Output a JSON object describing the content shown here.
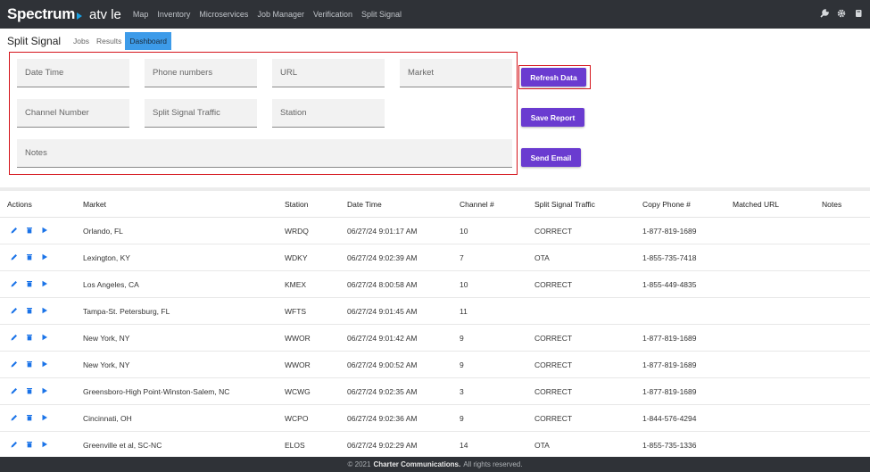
{
  "header": {
    "logo": "Spectrum",
    "app_name": "atv le",
    "nav": [
      "Map",
      "Inventory",
      "Microservices",
      "Job Manager",
      "Verification",
      "Split Signal"
    ],
    "icons": [
      "wrench-icon",
      "gear-icon",
      "book-icon"
    ]
  },
  "subheader": {
    "title": "Split Signal",
    "tabs": [
      "Jobs",
      "Results",
      "Dashboard"
    ],
    "active_tab": "Dashboard"
  },
  "form": {
    "date_time": "Date Time",
    "phone_numbers": "Phone numbers",
    "url": "URL",
    "market": "Market",
    "channel_number": "Channel Number",
    "split_signal_traffic": "Split Signal Traffic",
    "station": "Station",
    "notes": "Notes"
  },
  "buttons": {
    "refresh": "Refresh Data",
    "save": "Save Report",
    "email": "Send Email"
  },
  "table": {
    "headers": {
      "actions": "Actions",
      "market": "Market",
      "station": "Station",
      "datetime": "Date Time",
      "channel": "Channel #",
      "traffic": "Split Signal Traffic",
      "phone": "Copy Phone #",
      "url": "Matched URL",
      "notes": "Notes"
    },
    "rows": [
      {
        "market": "Orlando, FL",
        "station": "WRDQ",
        "datetime": "06/27/24 9:01:17 AM",
        "channel": "10",
        "traffic": "CORRECT",
        "phone": "1-877-819-1689"
      },
      {
        "market": "Lexington, KY",
        "station": "WDKY",
        "datetime": "06/27/24 9:02:39 AM",
        "channel": "7",
        "traffic": "OTA",
        "phone": "1-855-735-7418"
      },
      {
        "market": "Los Angeles, CA",
        "station": "KMEX",
        "datetime": "06/27/24 8:00:58 AM",
        "channel": "10",
        "traffic": "CORRECT",
        "phone": "1-855-449-4835"
      },
      {
        "market": "Tampa-St. Petersburg, FL",
        "station": "WFTS",
        "datetime": "06/27/24 9:01:45 AM",
        "channel": "11",
        "traffic": "",
        "phone": ""
      },
      {
        "market": "New York, NY",
        "station": "WWOR",
        "datetime": "06/27/24 9:01:42 AM",
        "channel": "9",
        "traffic": "CORRECT",
        "phone": "1-877-819-1689"
      },
      {
        "market": "New York, NY",
        "station": "WWOR",
        "datetime": "06/27/24 9:00:52 AM",
        "channel": "9",
        "traffic": "CORRECT",
        "phone": "1-877-819-1689"
      },
      {
        "market": "Greensboro-High Point-Winston-Salem, NC",
        "station": "WCWG",
        "datetime": "06/27/24 9:02:35 AM",
        "channel": "3",
        "traffic": "CORRECT",
        "phone": "1-877-819-1689"
      },
      {
        "market": "Cincinnati, OH",
        "station": "WCPO",
        "datetime": "06/27/24 9:02:36 AM",
        "channel": "9",
        "traffic": "CORRECT",
        "phone": "1-844-576-4294"
      },
      {
        "market": "Greenville et al, SC-NC",
        "station": "ELOS",
        "datetime": "06/27/24 9:02:29 AM",
        "channel": "14",
        "traffic": "OTA",
        "phone": "1-855-735-1336"
      }
    ]
  },
  "footer": {
    "prefix": "© 2021",
    "company": "Charter Communications.",
    "suffix": "All rights reserved."
  },
  "colors": {
    "accent": "#6a3bd0",
    "highlight": "#d5141b",
    "action_icon": "#1a73e8",
    "topbar": "#2f3237"
  }
}
